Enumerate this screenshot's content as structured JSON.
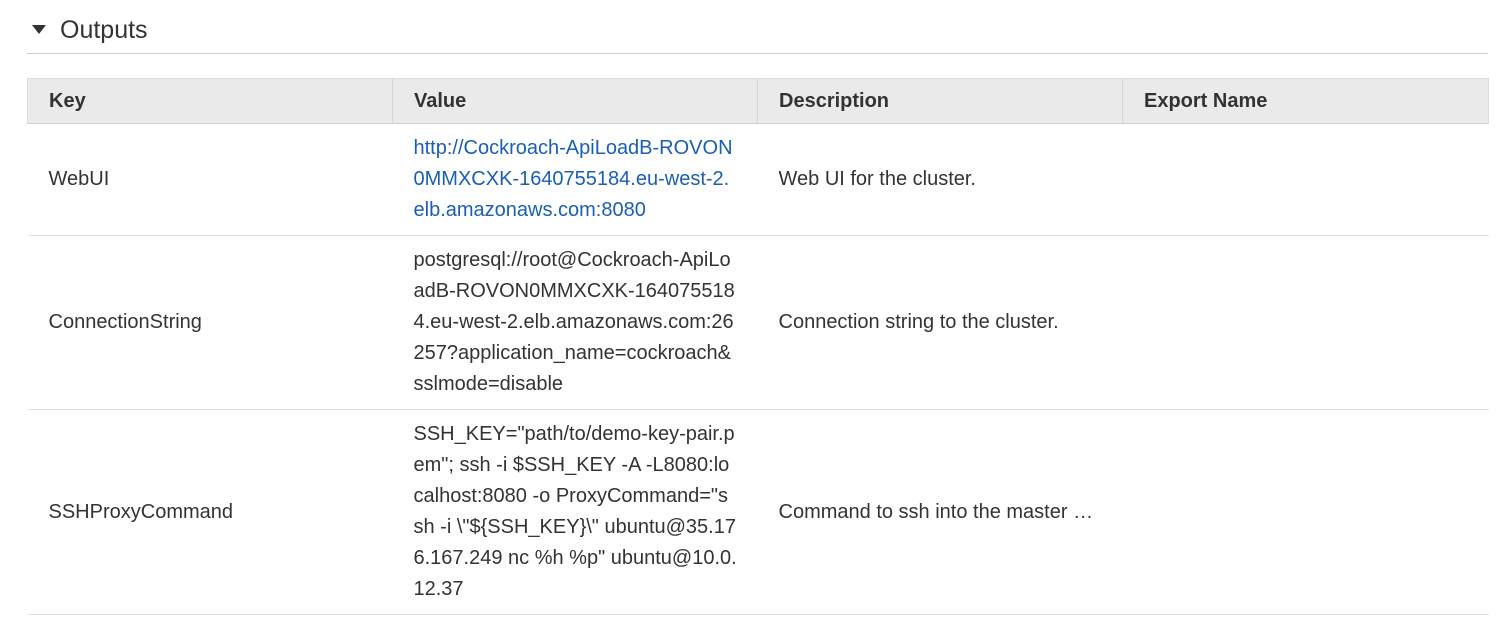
{
  "section": {
    "title": "Outputs"
  },
  "table": {
    "headers": [
      "Key",
      "Value",
      "Description",
      "Export Name"
    ],
    "rows": [
      {
        "key": "WebUI",
        "value": "http://Cockroach-ApiLoadB-ROVON0MMXCXK-1640755184.eu-west-2.elb.amazonaws.com:8080",
        "value_is_link": true,
        "description": "Web UI for the cluster.",
        "export_name": ""
      },
      {
        "key": "ConnectionString",
        "value": "postgresql://root@Cockroach-ApiLoadB-ROVON0MMXCXK-1640755184.eu-west-2.elb.amazonaws.com:26257?application_name=cockroach&sslmode=disable",
        "value_is_link": false,
        "description": "Connection string to the cluster.",
        "export_name": ""
      },
      {
        "key": "SSHProxyCommand",
        "value": "SSH_KEY=\"path/to/demo-key-pair.pem\"; ssh -i $SSH_KEY -A -L8080:localhost:8080 -o ProxyCommand=\"ssh -i \\\"${SSH_KEY}\\\" ubuntu@35.176.167.249 nc %h %p\" ubuntu@10.0.12.37",
        "value_is_link": false,
        "description": "Command to ssh into the master …",
        "export_name": ""
      }
    ]
  },
  "colors": {
    "link": "#1a5fb4",
    "header_bg": "#eaeaea",
    "text": "#333333"
  }
}
